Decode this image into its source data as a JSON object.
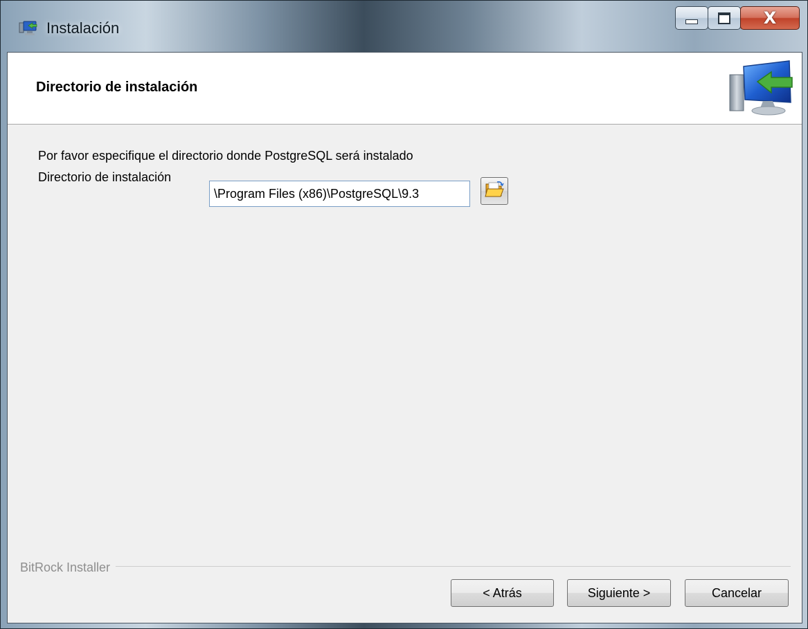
{
  "window": {
    "title": "Instalación",
    "controls": {
      "minimize": "minimize-icon",
      "maximize": "maximize-icon",
      "close": "close-icon"
    }
  },
  "header": {
    "title": "Directorio de instalación",
    "graphic": "install-computer-icon"
  },
  "body": {
    "prompt": "Por favor especifique el directorio donde PostgreSQL será instalado",
    "dir_label": "Directorio de instalación",
    "dir_value": "\\Program Files (x86)\\PostgreSQL\\9.3",
    "browse_icon": "folder-open-icon"
  },
  "footer": {
    "group_label": "BitRock Installer",
    "back_label": "< Atrás",
    "next_label": "Siguiente >",
    "cancel_label": "Cancelar"
  }
}
